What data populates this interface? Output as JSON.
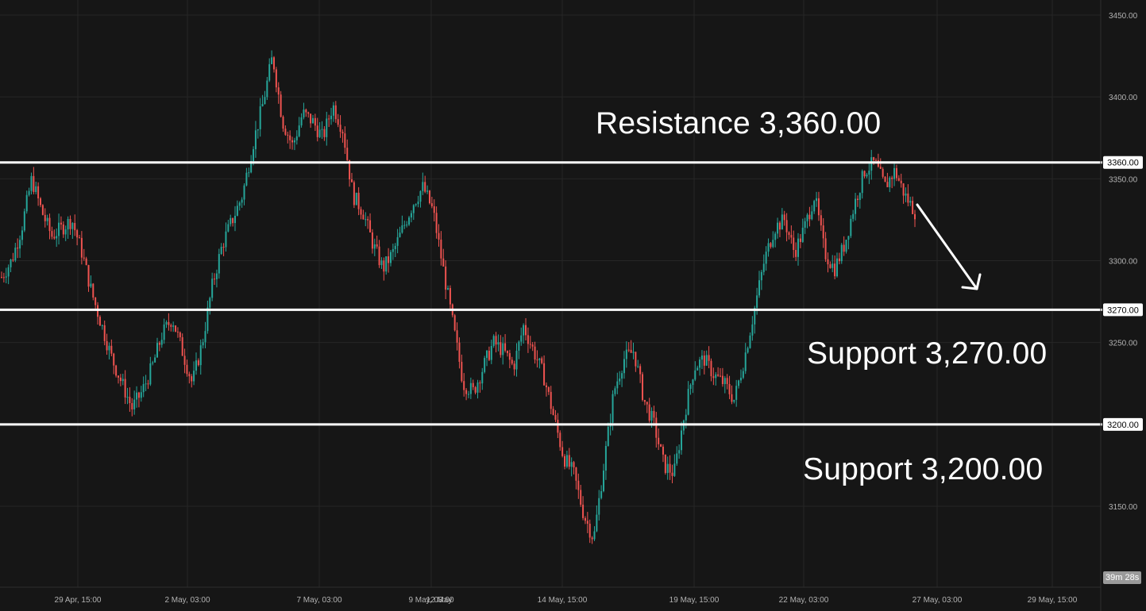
{
  "chart_data": {
    "type": "candlestick",
    "y_ticks": [
      "3450.00",
      "3400.00",
      "3350.00",
      "3300.00",
      "3250.00",
      "3150.00"
    ],
    "ylim": [
      3110,
      3455
    ],
    "x_ticks": [
      "29 Apr, 15:00",
      "2 May, 03:00",
      "7 May, 03:00",
      "9 May, 03:00",
      "12 May",
      "14 May, 15:00",
      "19 May, 15:00",
      "22 May, 03:00",
      "27 May, 03:00",
      "29 May, 15:00"
    ],
    "levels": [
      {
        "name": "resistance",
        "value": 3360,
        "label": "3360.00"
      },
      {
        "name": "support-1",
        "value": 3270,
        "label": "3270.00"
      },
      {
        "name": "support-2",
        "value": 3200,
        "label": "3200.00"
      }
    ],
    "annotations": {
      "resistance": "Resistance  3,360.00",
      "support_1": "Support 3,270.00",
      "support_2": "Support 3,200.00"
    },
    "countdown": "39m 28s",
    "price_path": [
      3290,
      3300,
      3320,
      3350,
      3330,
      3315,
      3320,
      3325,
      3305,
      3280,
      3260,
      3240,
      3225,
      3210,
      3220,
      3235,
      3255,
      3265,
      3245,
      3225,
      3250,
      3285,
      3310,
      3325,
      3340,
      3370,
      3395,
      3425,
      3385,
      3370,
      3390,
      3385,
      3375,
      3395,
      3380,
      3340,
      3330,
      3310,
      3295,
      3305,
      3320,
      3335,
      3345,
      3330,
      3295,
      3260,
      3225,
      3220,
      3235,
      3250,
      3245,
      3235,
      3260,
      3245,
      3230,
      3205,
      3180,
      3170,
      3145,
      3130,
      3175,
      3220,
      3240,
      3245,
      3215,
      3200,
      3175,
      3170,
      3205,
      3235,
      3240,
      3230,
      3225,
      3215,
      3240,
      3270,
      3300,
      3320,
      3325,
      3305,
      3320,
      3340,
      3305,
      3295,
      3310,
      3335,
      3355,
      3360,
      3345,
      3355,
      3340,
      3330
    ],
    "colors": {
      "up": "#26a69a",
      "down": "#ef5350",
      "background": "#161616",
      "grid": "#262626",
      "level_line": "#ffffff"
    }
  }
}
